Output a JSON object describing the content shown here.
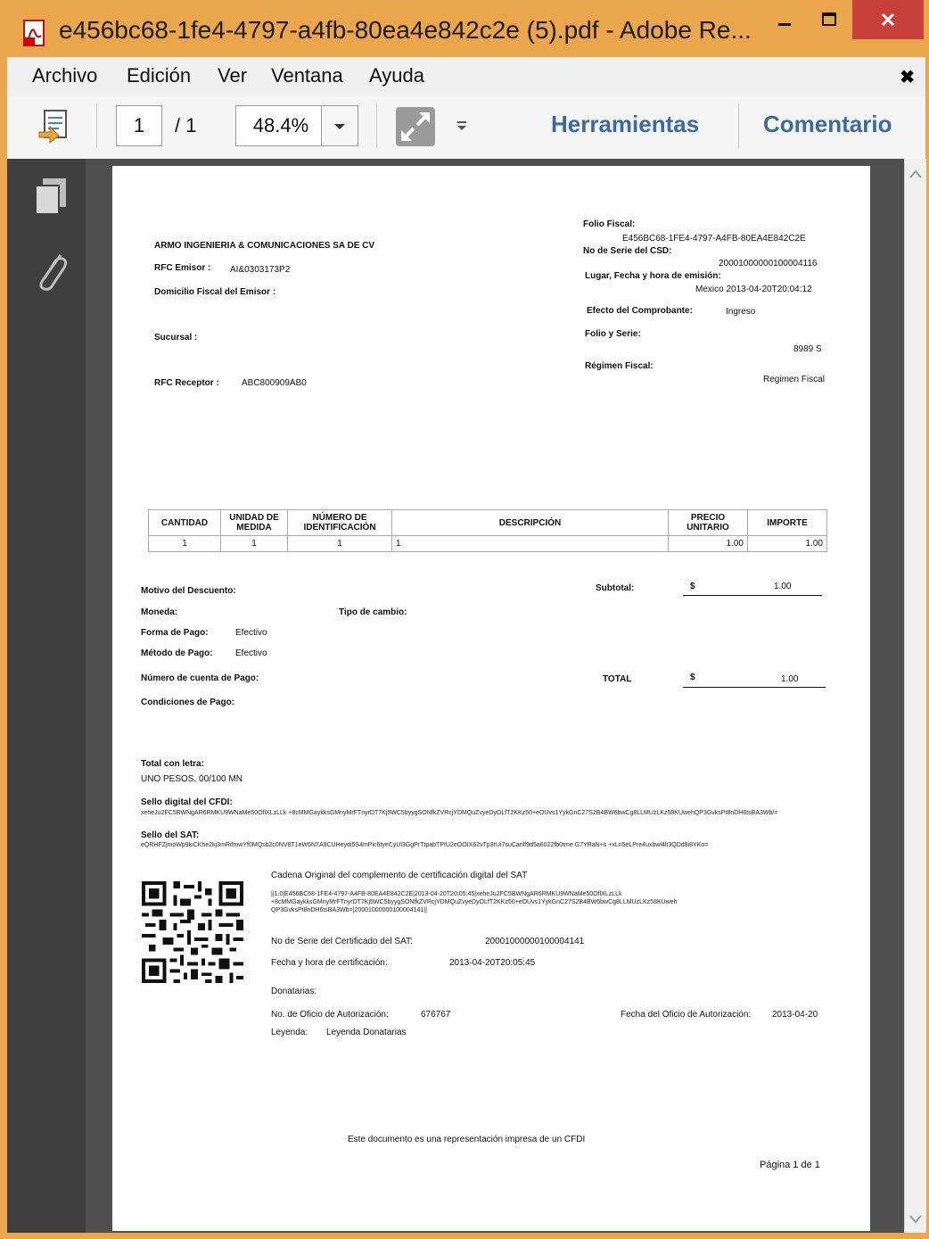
{
  "window": {
    "title": "e456bc68-1fe4-4797-a4fb-80ea4e842c2e (5).pdf - Adobe Re...",
    "min_glyph": "–",
    "max_glyph": "☐",
    "close_glyph": "×"
  },
  "menu": {
    "items": [
      "Archivo",
      "Edición",
      "Ver",
      "Ventana",
      "Ayuda"
    ],
    "close_glyph": "✖"
  },
  "toolbar": {
    "page_current": "1",
    "page_total": "/ 1",
    "zoom": "48.4%",
    "tools_label": "Herramientas",
    "comment_label": "Comentario"
  },
  "icons": {
    "window": "pdf-file-icon",
    "toolbar": [
      "save-to-page-icon",
      "zoom-dropdown-chevron-icon",
      "fullscreen-arrows-icon",
      "toolbar-options-icon"
    ],
    "navpane": [
      "pages-thumbnail-icon",
      "attachments-paperclip-icon"
    ],
    "scroll": [
      "scroll-up-icon",
      "scroll-down-icon"
    ]
  },
  "document": {
    "company": "ARMO INGENIERIA & COMUNICACIONES SA DE CV",
    "rfc_emisor_label": "RFC Emisor :",
    "rfc_emisor": "AI&0303173P2",
    "domicilio_label": "Domicilio Fiscal del Emisor :",
    "sucursal_label": "Sucursal :",
    "rfc_receptor_label": "RFC Receptor :",
    "rfc_receptor": "ABC800909AB0",
    "folio_fiscal_label": "Folio Fiscal:",
    "folio_fiscal": "E456BC68-1FE4-4797-A4FB-80EA4E842C2E",
    "serie_csd_label": "No de Serie del CSD:",
    "serie_csd": "20001000000100004116",
    "lugar_label": "Lugar, Fecha y hora de emisión:",
    "lugar": "Mexico  2013-04-20T20:04:12",
    "efecto_label": "Efecto del Comprobante:",
    "efecto": "Ingreso",
    "folio_serie_label": "Folio y Serie:",
    "folio_serie": "8989  S",
    "regimen_label": "Régimen Fiscal:",
    "regimen": "Regimen Fiscal",
    "table": {
      "headers": [
        "CANTIDAD",
        "UNIDAD DE MEDIDA",
        "NÚMERO DE IDENTIFICACIÓN",
        "DESCRIPCIÓN",
        "PRECIO UNITARIO",
        "IMPORTE"
      ],
      "rows": [
        [
          "1",
          "1",
          "1",
          "1",
          "1.00",
          "1.00"
        ]
      ]
    },
    "motivo_label": "Motivo del Descuento:",
    "moneda_label": "Moneda:",
    "tipo_cambio_label": "Tipo de cambio:",
    "forma_pago_label": "Forma de Pago:",
    "forma_pago": "Efectivo",
    "metodo_pago_label": "Método de Pago:",
    "metodo_pago": "Efectivo",
    "cuenta_label": "Número de cuenta de Pago:",
    "condiciones_label": "Condiciones de Pago:",
    "subtotal_label": "Subtotal:",
    "currency": "$",
    "subtotal": "1.00",
    "total_label": "TOTAL",
    "total": "1.00",
    "total_letra_label": "Total con letra:",
    "total_letra": "UNO PESOS, 00/100 MN",
    "sello_cfdi_label": "Sello digital del CFDI:",
    "sello_cfdi": "xeheJu2FC5BWNgAR6RMKU9WNaMe50OflXLzLLk +8cMMGaykksGMnyMrFTnyrDT7Kj5WC5byygSONfkZVRcjYDMQuZvyeDyOLfT2KKz50+eOUvs1YykGnC27S2B4BW6bwCg8LLMUzLKz58KUwehQP3GvksPt8nDH6tsBA3Wb/=",
    "sello_sat_label": "Sello del SAT:",
    "sello_sat": "eQRHFZjmoWp9kiCKhe2kj3mRifmwYf0MQsb2c0NV8T1eW6N7A9CUHeydi5S4mPic6tyeCyUl3GgPrTtpabTPIU2eOOIX62vTp3rUi7suCanlf9d5a6022fb0tme G7YRaN+s +xLn5eLPre4uxbwl4lt3QDd8i8YKo=",
    "cadena_label": "Cadena Original del complemento de certificación digital del SAT",
    "cadena": "||1.0|E456BC68-1FE4-4797-A4FB-80EA4E842C2E|2013-04-20T20:05:45|xeheJu2FC5BWNgAR6RMKU9WNaMe50OflXLzLLk +8cMMGaykksGMnyMrFTnyrDT7Kj5WC5byygSONfkZVRcjYDMQuZvyeDyOLfT2KKz50+eOUvs1YykGnC27S2B4BW6bwCg8LLMUzLKz58KUweh QP3GvksPt8nDH6tsBA3Wb=|20001000000100004141||",
    "cert_sat_label": "No de Serie del Certificado del SAT:",
    "cert_sat": "20001000000100004141",
    "fecha_cert_label": "Fecha y hora de certificación:",
    "fecha_cert": "2013-04-20T20:05:45",
    "donatarias_label": "Donatarias:",
    "oficio_label": "No. de Oficio de Autorización:",
    "oficio": "676767",
    "fecha_oficio_label": "Fecha del Oficio de Autorización:",
    "fecha_oficio": "2013-04-20",
    "leyenda_label": "Leyenda:",
    "leyenda": "Leyenda Donatarias",
    "footer_note": "Este documento es una representación impresa de un CFDI",
    "page_label": "Página 1 de 1"
  }
}
